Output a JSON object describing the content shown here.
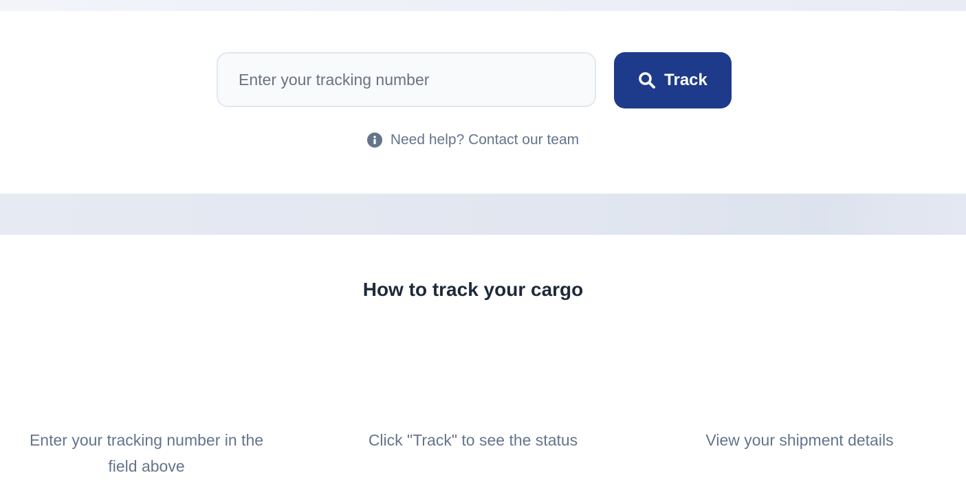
{
  "tracking": {
    "input_placeholder": "Enter your tracking number",
    "input_value": "",
    "button_label": "Track",
    "button_icon": "search-icon",
    "help_icon": "info-icon",
    "help_text": "Need help? Contact our team"
  },
  "how_to": {
    "title": "How to track your cargo",
    "steps": [
      {
        "text": "Enter your tracking number in the field above"
      },
      {
        "text": "Click \"Track\" to see the status"
      },
      {
        "text": "View your shipment details"
      }
    ]
  },
  "colors": {
    "primary": "#1e3a8a",
    "muted_text": "#64748b",
    "heading_text": "#1e293b",
    "input_background": "#f8fafc",
    "input_border": "#e2e8f0",
    "band_background": "#e1e6f0"
  }
}
